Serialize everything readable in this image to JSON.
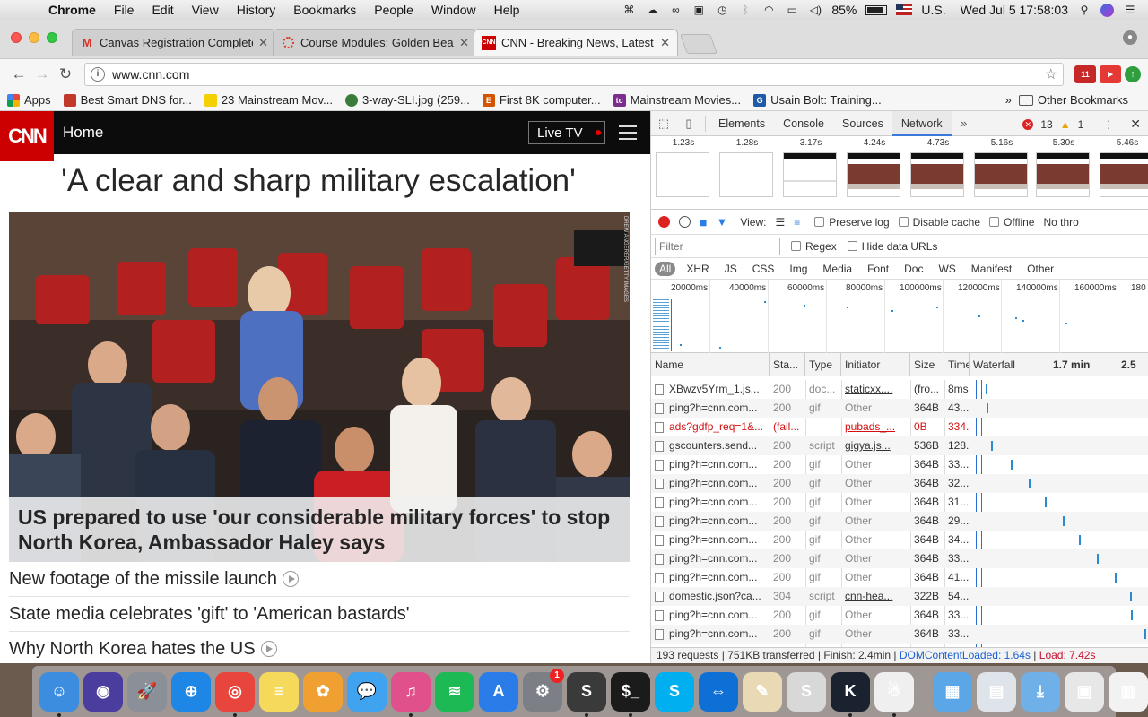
{
  "menubar": {
    "app": "Chrome",
    "items": [
      "File",
      "Edit",
      "View",
      "History",
      "Bookmarks",
      "People",
      "Window",
      "Help"
    ],
    "battery": "85%",
    "input_source": "U.S.",
    "datetime": "Wed Jul 5  17:58:03"
  },
  "tabs": [
    {
      "title": "Canvas Registration Complete",
      "favicon": "gmail-icon",
      "active": false
    },
    {
      "title": "Course Modules: Golden Bears",
      "favicon": "canvas-icon",
      "active": false
    },
    {
      "title": "CNN - Breaking News, Latest N",
      "favicon": "cnn-icon",
      "active": true
    }
  ],
  "toolbar": {
    "url": "www.cnn.com",
    "ext_badge": "11"
  },
  "bookmarks": {
    "items": [
      {
        "label": "Apps",
        "icon": "apps-grid-icon",
        "color": "#e8453c"
      },
      {
        "label": "Best Smart DNS for...",
        "icon": "bookmark-fav-icon",
        "color": "#c0392b"
      },
      {
        "label": "23 Mainstream Mov...",
        "icon": "bookmark-fav-icon",
        "color": "#f4d000"
      },
      {
        "label": "3-way-SLI.jpg (259...",
        "icon": "bookmark-fav-icon",
        "color": "#3a7d3a"
      },
      {
        "label": "First 8K computer...",
        "icon": "bookmark-fav-icon",
        "color": "#d35400"
      },
      {
        "label": "Mainstream Movies...",
        "icon": "bookmark-fav-icon",
        "color": "#7b2d8e"
      },
      {
        "label": "Usain Bolt: Training...",
        "icon": "bookmark-fav-icon",
        "color": "#1e5aa8"
      }
    ],
    "other": "Other Bookmarks"
  },
  "cnn": {
    "logo": "CNN",
    "section": "Home",
    "live_tv": "Live TV",
    "headline": "'A clear and sharp military escalation'",
    "hero_caption": "US prepared to use 'our considerable military forces' to stop North Korea, Ambassador Haley says",
    "photo_credit": "DREW ANGERER/GETTY IMAGES",
    "stories": [
      {
        "text": "New footage of the missile launch",
        "video": true
      },
      {
        "text": "State media celebrates 'gift' to 'American bastards'",
        "video": false
      },
      {
        "text": "Why North Korea hates the US",
        "video": true
      }
    ]
  },
  "devtools": {
    "tabs": [
      "Elements",
      "Console",
      "Sources",
      "Network"
    ],
    "active_tab": "Network",
    "errors": "13",
    "warnings": "1",
    "filmstrip": [
      "1.23s",
      "1.28s",
      "3.17s",
      "4.24s",
      "4.73s",
      "5.16s",
      "5.30s",
      "5.46s"
    ],
    "view_label": "View:",
    "preserve_log": "Preserve log",
    "disable_cache": "Disable cache",
    "offline": "Offline",
    "throttle": "No thro",
    "filter_placeholder": "Filter",
    "regex": "Regex",
    "hide_data_urls": "Hide data URLs",
    "types": [
      "All",
      "XHR",
      "JS",
      "CSS",
      "Img",
      "Media",
      "Font",
      "Doc",
      "WS",
      "Manifest",
      "Other"
    ],
    "overview_ticks": [
      "20000ms",
      "40000ms",
      "60000ms",
      "80000ms",
      "100000ms",
      "120000ms",
      "140000ms",
      "160000ms",
      "180"
    ],
    "columns": [
      "Name",
      "Sta...",
      "Type",
      "Initiator",
      "Size",
      "Time",
      "Waterfall",
      "1.7 min",
      "2.5"
    ],
    "rows": [
      {
        "name": "XBwzv5Yrm_1.js...",
        "status": "200",
        "type": "doc...",
        "initiator": "staticxx....",
        "size": "(fro...",
        "time": "8ms",
        "link": true,
        "failed": false,
        "wf": 0.03
      },
      {
        "name": "ping?h=cnn.com...",
        "status": "200",
        "type": "gif",
        "initiator": "Other",
        "size": "364B",
        "time": "43...",
        "link": false,
        "failed": false,
        "wf": 0.035
      },
      {
        "name": "ads?gdfp_req=1&...",
        "status": "(fail...",
        "type": "",
        "initiator": "pubads_...",
        "size": "0B",
        "time": "334...",
        "link": true,
        "failed": true,
        "wf": -1
      },
      {
        "name": "gscounters.send...",
        "status": "200",
        "type": "script",
        "initiator": "gigya.js...",
        "size": "536B",
        "time": "128...",
        "link": true,
        "failed": false,
        "wf": 0.06
      },
      {
        "name": "ping?h=cnn.com...",
        "status": "200",
        "type": "gif",
        "initiator": "Other",
        "size": "364B",
        "time": "33...",
        "link": false,
        "failed": false,
        "wf": 0.18
      },
      {
        "name": "ping?h=cnn.com...",
        "status": "200",
        "type": "gif",
        "initiator": "Other",
        "size": "364B",
        "time": "32...",
        "link": false,
        "failed": false,
        "wf": 0.29
      },
      {
        "name": "ping?h=cnn.com...",
        "status": "200",
        "type": "gif",
        "initiator": "Other",
        "size": "364B",
        "time": "31...",
        "link": false,
        "failed": false,
        "wf": 0.39
      },
      {
        "name": "ping?h=cnn.com...",
        "status": "200",
        "type": "gif",
        "initiator": "Other",
        "size": "364B",
        "time": "29...",
        "link": false,
        "failed": false,
        "wf": 0.5
      },
      {
        "name": "ping?h=cnn.com...",
        "status": "200",
        "type": "gif",
        "initiator": "Other",
        "size": "364B",
        "time": "34...",
        "link": false,
        "failed": false,
        "wf": 0.6
      },
      {
        "name": "ping?h=cnn.com...",
        "status": "200",
        "type": "gif",
        "initiator": "Other",
        "size": "364B",
        "time": "33...",
        "link": false,
        "failed": false,
        "wf": 0.71
      },
      {
        "name": "ping?h=cnn.com...",
        "status": "200",
        "type": "gif",
        "initiator": "Other",
        "size": "364B",
        "time": "41...",
        "link": false,
        "failed": false,
        "wf": 0.82
      },
      {
        "name": "domestic.json?ca...",
        "status": "304",
        "type": "script",
        "initiator": "cnn-hea...",
        "size": "322B",
        "time": "54...",
        "link": true,
        "failed": false,
        "wf": 0.91
      },
      {
        "name": "ping?h=cnn.com...",
        "status": "200",
        "type": "gif",
        "initiator": "Other",
        "size": "364B",
        "time": "33...",
        "link": false,
        "failed": false,
        "wf": 0.92
      },
      {
        "name": "ping?h=cnn.com...",
        "status": "200",
        "type": "gif",
        "initiator": "Other",
        "size": "364B",
        "time": "33...",
        "link": false,
        "failed": false,
        "wf": 1.0
      }
    ],
    "status": {
      "requests": "193 requests",
      "transferred": "751KB transferred",
      "finish": "Finish: 2.4min",
      "dcl": "DOMContentLoaded: 1.64s",
      "load": "Load: 7.42s"
    }
  },
  "dock": [
    {
      "name": "finder-icon",
      "color": "#3c8de0",
      "glyph": "☺",
      "running": true
    },
    {
      "name": "siri-icon",
      "color": "#4a3d9e",
      "glyph": "◉",
      "running": false
    },
    {
      "name": "launchpad-icon",
      "color": "#8a8f98",
      "glyph": "🚀",
      "running": false
    },
    {
      "name": "safari-icon",
      "color": "#1e86e5",
      "glyph": "⊕",
      "running": false
    },
    {
      "name": "chrome-icon",
      "color": "#e8453c",
      "glyph": "◎",
      "running": true
    },
    {
      "name": "notes-icon",
      "color": "#f5d95a",
      "glyph": "≡",
      "running": false
    },
    {
      "name": "photos-icon",
      "color": "#f0a030",
      "glyph": "✿",
      "running": false
    },
    {
      "name": "messages-icon",
      "color": "#3fa3f0",
      "glyph": "💬",
      "running": false
    },
    {
      "name": "itunes-icon",
      "color": "#e0508a",
      "glyph": "♫",
      "running": true
    },
    {
      "name": "spotify-icon",
      "color": "#1db954",
      "glyph": "≋",
      "running": false
    },
    {
      "name": "app-store-icon",
      "color": "#2a7de8",
      "glyph": "A",
      "running": false
    },
    {
      "name": "system-preferences-icon",
      "color": "#7c7f86",
      "glyph": "⚙",
      "running": false,
      "badge": "1"
    },
    {
      "name": "sublime-text-icon",
      "color": "#3a3a3a",
      "glyph": "S",
      "running": true
    },
    {
      "name": "terminal-icon",
      "color": "#1b1b1b",
      "glyph": "$_",
      "running": true
    },
    {
      "name": "skype-icon",
      "color": "#00aff0",
      "glyph": "S",
      "running": false
    },
    {
      "name": "teamviewer-icon",
      "color": "#0e6fd4",
      "glyph": "⇔",
      "running": false
    },
    {
      "name": "textedit-icon",
      "color": "#e9d9b5",
      "glyph": "✎",
      "running": false
    },
    {
      "name": "slack-icon",
      "color": "#d8d8d8",
      "glyph": "S",
      "running": false
    },
    {
      "name": "kindle-icon",
      "color": "#1a2230",
      "glyph": "K",
      "running": true
    },
    {
      "name": "cobook-icon",
      "color": "#efefef",
      "glyph": "☃",
      "running": true
    },
    {
      "name": "applications-folder-icon",
      "color": "#5aa6e6",
      "glyph": "▦",
      "running": false
    },
    {
      "name": "document-icon",
      "color": "#dfe3ea",
      "glyph": "▤",
      "running": false
    },
    {
      "name": "downloads-folder-icon",
      "color": "#6fb0e8",
      "glyph": "⤓",
      "running": false
    },
    {
      "name": "screenshot-stack-icon",
      "color": "#e7e7e7",
      "glyph": "▣",
      "running": false
    },
    {
      "name": "document-stack-icon",
      "color": "#f2f2f2",
      "glyph": "▥",
      "running": false
    },
    {
      "name": "trash-icon",
      "color": "#cfd3d8",
      "glyph": "🗑",
      "running": false
    }
  ]
}
